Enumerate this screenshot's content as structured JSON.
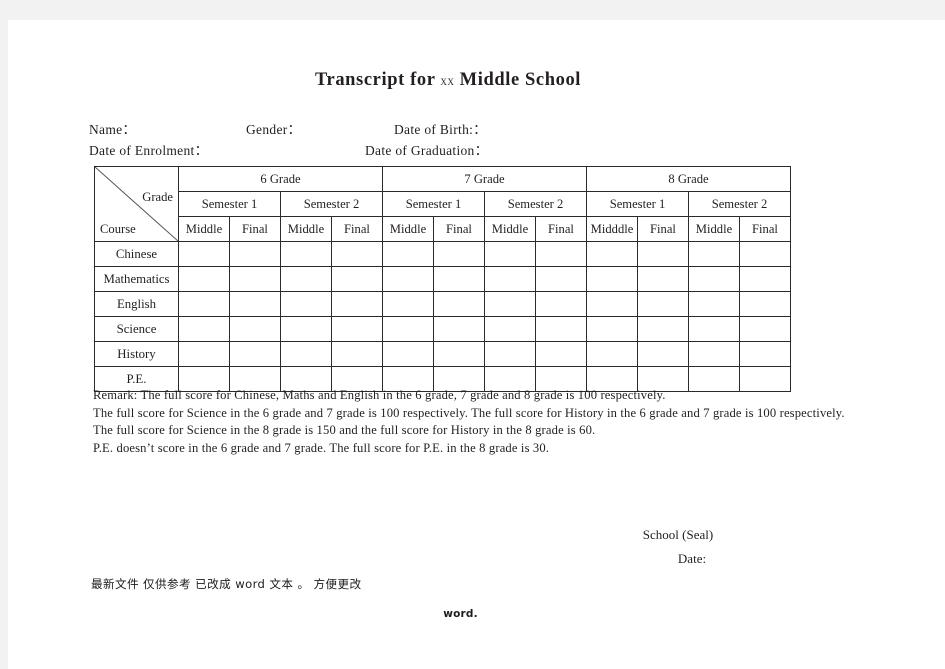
{
  "document": {
    "title_prefix": "Transcript for",
    "title_school_code": "xx",
    "title_suffix": "Middle School"
  },
  "header_fields": {
    "name_label": "Name：",
    "gender_label": "Gender：",
    "date_of_birth_label": "Date of Birth:：",
    "date_of_enrolment_label": "Date of Enrolment：",
    "date_of_graduation_label": "Date of Graduation：",
    "name_value": "",
    "gender_value": "",
    "date_of_birth_value": "",
    "date_of_enrolment_value": "",
    "date_of_graduation_value": ""
  },
  "table": {
    "corner": {
      "grade_label": "Grade",
      "course_label": "Course"
    },
    "grades": [
      {
        "label": "6 Grade",
        "semesters": [
          {
            "label": "Semester 1",
            "terms": [
              "Middle",
              "Final"
            ]
          },
          {
            "label": "Semester 2",
            "terms": [
              "Middle",
              "Final"
            ]
          }
        ]
      },
      {
        "label": "7 Grade",
        "semesters": [
          {
            "label": "Semester 1",
            "terms": [
              "Middle",
              "Final"
            ]
          },
          {
            "label": "Semester 2",
            "terms": [
              "Middle",
              "Final"
            ]
          }
        ]
      },
      {
        "label": "8 Grade",
        "semesters": [
          {
            "label": "Semester 1",
            "terms": [
              "Midddle",
              "Final"
            ]
          },
          {
            "label": "Semester 2",
            "terms": [
              "Middle",
              "Final"
            ]
          }
        ]
      }
    ],
    "courses": [
      {
        "name": "Chinese",
        "scores": [
          "",
          "",
          "",
          "",
          "",
          "",
          "",
          "",
          "",
          "",
          "",
          ""
        ]
      },
      {
        "name": "Mathematics",
        "scores": [
          "",
          "",
          "",
          "",
          "",
          "",
          "",
          "",
          "",
          "",
          "",
          ""
        ]
      },
      {
        "name": "English",
        "scores": [
          "",
          "",
          "",
          "",
          "",
          "",
          "",
          "",
          "",
          "",
          "",
          ""
        ]
      },
      {
        "name": "Science",
        "scores": [
          "",
          "",
          "",
          "",
          "",
          "",
          "",
          "",
          "",
          "",
          "",
          ""
        ]
      },
      {
        "name": "History",
        "scores": [
          "",
          "",
          "",
          "",
          "",
          "",
          "",
          "",
          "",
          "",
          "",
          ""
        ]
      },
      {
        "name": "P.E.",
        "scores": [
          "",
          "",
          "",
          "",
          "",
          "",
          "",
          "",
          "",
          "",
          "",
          ""
        ]
      }
    ]
  },
  "remarks": {
    "line1": "Remark: The full score for Chinese, Maths and English in the 6 grade, 7 grade and 8 grade is 100 respectively.",
    "line2": "The full score for Science in the 6 grade and 7 grade is 100 respectively. The full score for History in the 6 grade and 7 grade is 100 respectively.",
    "line3": "The full score for Science in the 8 grade is 150 and the full score for History in the 8 grade is 60.",
    "line4": "P.E. doesn’t score in the 6 grade and 7 grade. The full score for P.E. in the 8 grade is 30."
  },
  "signature": {
    "school_seal_label": "School (Seal)",
    "date_label": "Date:"
  },
  "footer": {
    "chinese_note": "最新文件  仅供参考 已改成 word 文本 。  方便更改",
    "word_mark": "word."
  },
  "colors": {
    "page_background": "#ffffff",
    "canvas_background": "#f2f2f3",
    "text": "#231f20",
    "table_border": "#2b2b2b"
  }
}
